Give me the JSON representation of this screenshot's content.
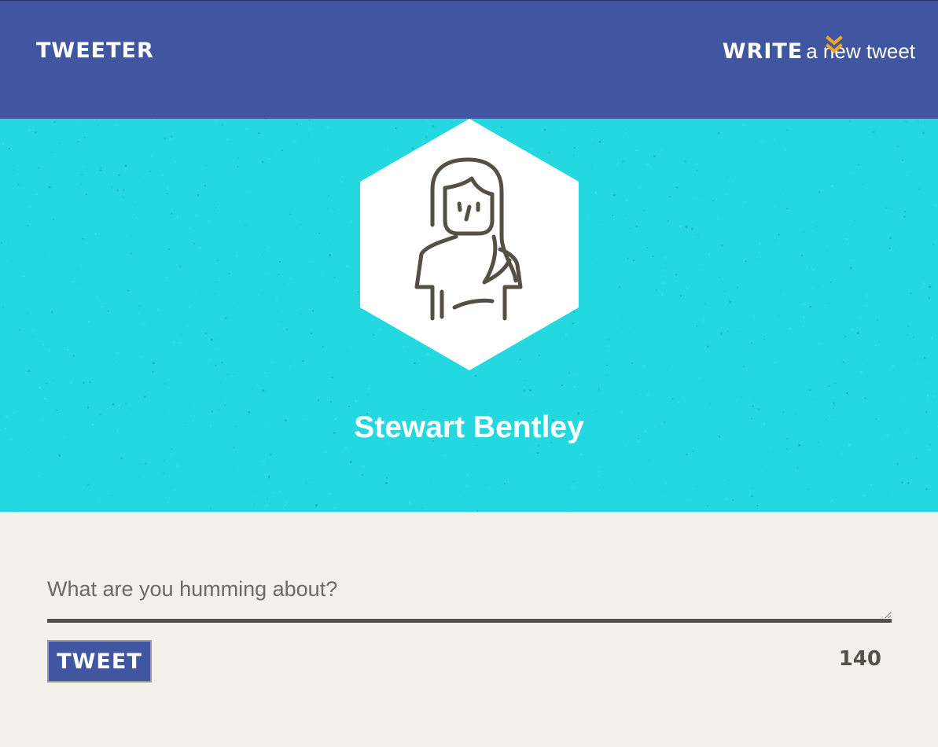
{
  "nav": {
    "logo": "Tweeter",
    "compose_toggle": {
      "bold_label": "Write",
      "rest_label": "a new tweet",
      "icon": "double-chevron-down-icon"
    }
  },
  "profile": {
    "avatar_icon": "user-avatar-icon",
    "name": "Stewart Bentley"
  },
  "composer": {
    "placeholder": "What are you humming about?",
    "value": "",
    "submit_label": "Tweet",
    "counter": "140"
  },
  "colors": {
    "nav_background": "#4056a1",
    "profile_background": "#24d8e0",
    "page_background": "#f4f1ec",
    "accent_chevron": "#f5a623",
    "text_dark": "#545149"
  }
}
